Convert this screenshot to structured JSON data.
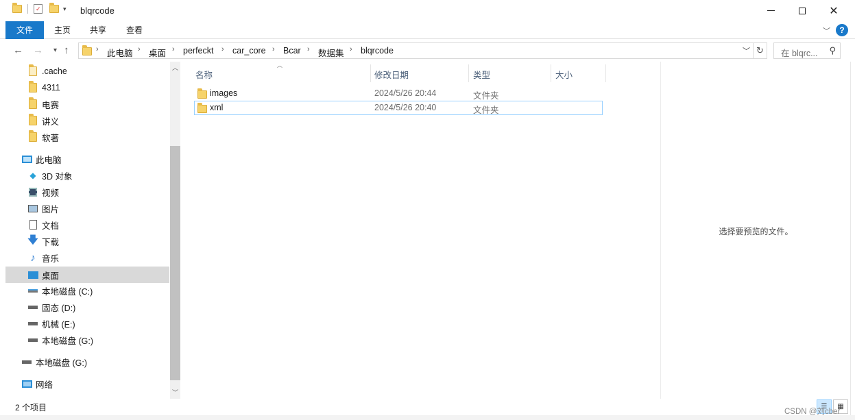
{
  "window": {
    "title": "blqrcode",
    "minimize_icon": "minimize-icon",
    "maximize_icon": "maximize-icon",
    "close_icon": "close-icon"
  },
  "ribbon": {
    "tabs": [
      "文件",
      "主页",
      "共享",
      "查看"
    ],
    "help": "?"
  },
  "address": {
    "crumbs": [
      "此电脑",
      "桌面",
      "perfeckt",
      "car_core",
      "Bcar",
      "数据集",
      "blqrcode"
    ],
    "search_placeholder": "在 blqrc..."
  },
  "nav": {
    "quick_access": [
      ".cache",
      "4311",
      "电赛",
      "讲义",
      "软著"
    ],
    "this_pc": "此电脑",
    "pc_items": [
      "3D 对象",
      "视频",
      "图片",
      "文档",
      "下载",
      "音乐",
      "桌面",
      "本地磁盘 (C:)",
      "固态 (D:)",
      "机械 (E:)",
      "本地磁盘 (G:)"
    ],
    "extra_drive": "本地磁盘 (G:)",
    "network": "网络",
    "selected": "桌面"
  },
  "columns": {
    "name": "名称",
    "modified": "修改日期",
    "type": "类型",
    "size": "大小"
  },
  "files": [
    {
      "name": "images",
      "modified": "2024/5/26 20:44",
      "type": "文件夹",
      "size": ""
    },
    {
      "name": "xml",
      "modified": "2024/5/26 20:40",
      "type": "文件夹",
      "size": ""
    }
  ],
  "preview": {
    "empty_text": "选择要预览的文件。"
  },
  "status": {
    "item_count": "2 个项目"
  },
  "watermark": "CSDN @刘cber"
}
